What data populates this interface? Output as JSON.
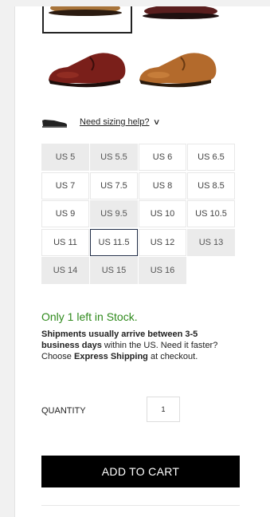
{
  "sizing": {
    "link_label": "Need sizing help?"
  },
  "sizes": [
    {
      "label": "US 5",
      "state": "unavailable"
    },
    {
      "label": "US 5.5",
      "state": "unavailable"
    },
    {
      "label": "US 6",
      "state": "available"
    },
    {
      "label": "US 6.5",
      "state": "available"
    },
    {
      "label": "US 7",
      "state": "available"
    },
    {
      "label": "US 7.5",
      "state": "available"
    },
    {
      "label": "US 8",
      "state": "available"
    },
    {
      "label": "US 8.5",
      "state": "available"
    },
    {
      "label": "US 9",
      "state": "available"
    },
    {
      "label": "US 9.5",
      "state": "unavailable"
    },
    {
      "label": "US 10",
      "state": "available"
    },
    {
      "label": "US 10.5",
      "state": "available"
    },
    {
      "label": "US 11",
      "state": "available"
    },
    {
      "label": "US 11.5",
      "state": "selected"
    },
    {
      "label": "US 12",
      "state": "available"
    },
    {
      "label": "US 13",
      "state": "unavailable"
    },
    {
      "label": "US 14",
      "state": "unavailable"
    },
    {
      "label": "US 15",
      "state": "unavailable"
    },
    {
      "label": "US 16",
      "state": "unavailable"
    }
  ],
  "stock": {
    "text": "Only 1 left in Stock."
  },
  "shipping": {
    "part1": "Shipments usually arrive between 3-5 business days",
    "part2": " within the US.  Need it faster?  Choose ",
    "part3": "Express Shipping",
    "part4": " at checkout."
  },
  "quantity": {
    "label": "QUANTITY",
    "value": "1"
  },
  "cart": {
    "button_label": "ADD TO CART"
  },
  "colors": {
    "stock_green": "#2f8a1c",
    "button_bg": "#000000",
    "unavailable_bg": "#ebebeb",
    "selected_border": "#1e2b45"
  }
}
